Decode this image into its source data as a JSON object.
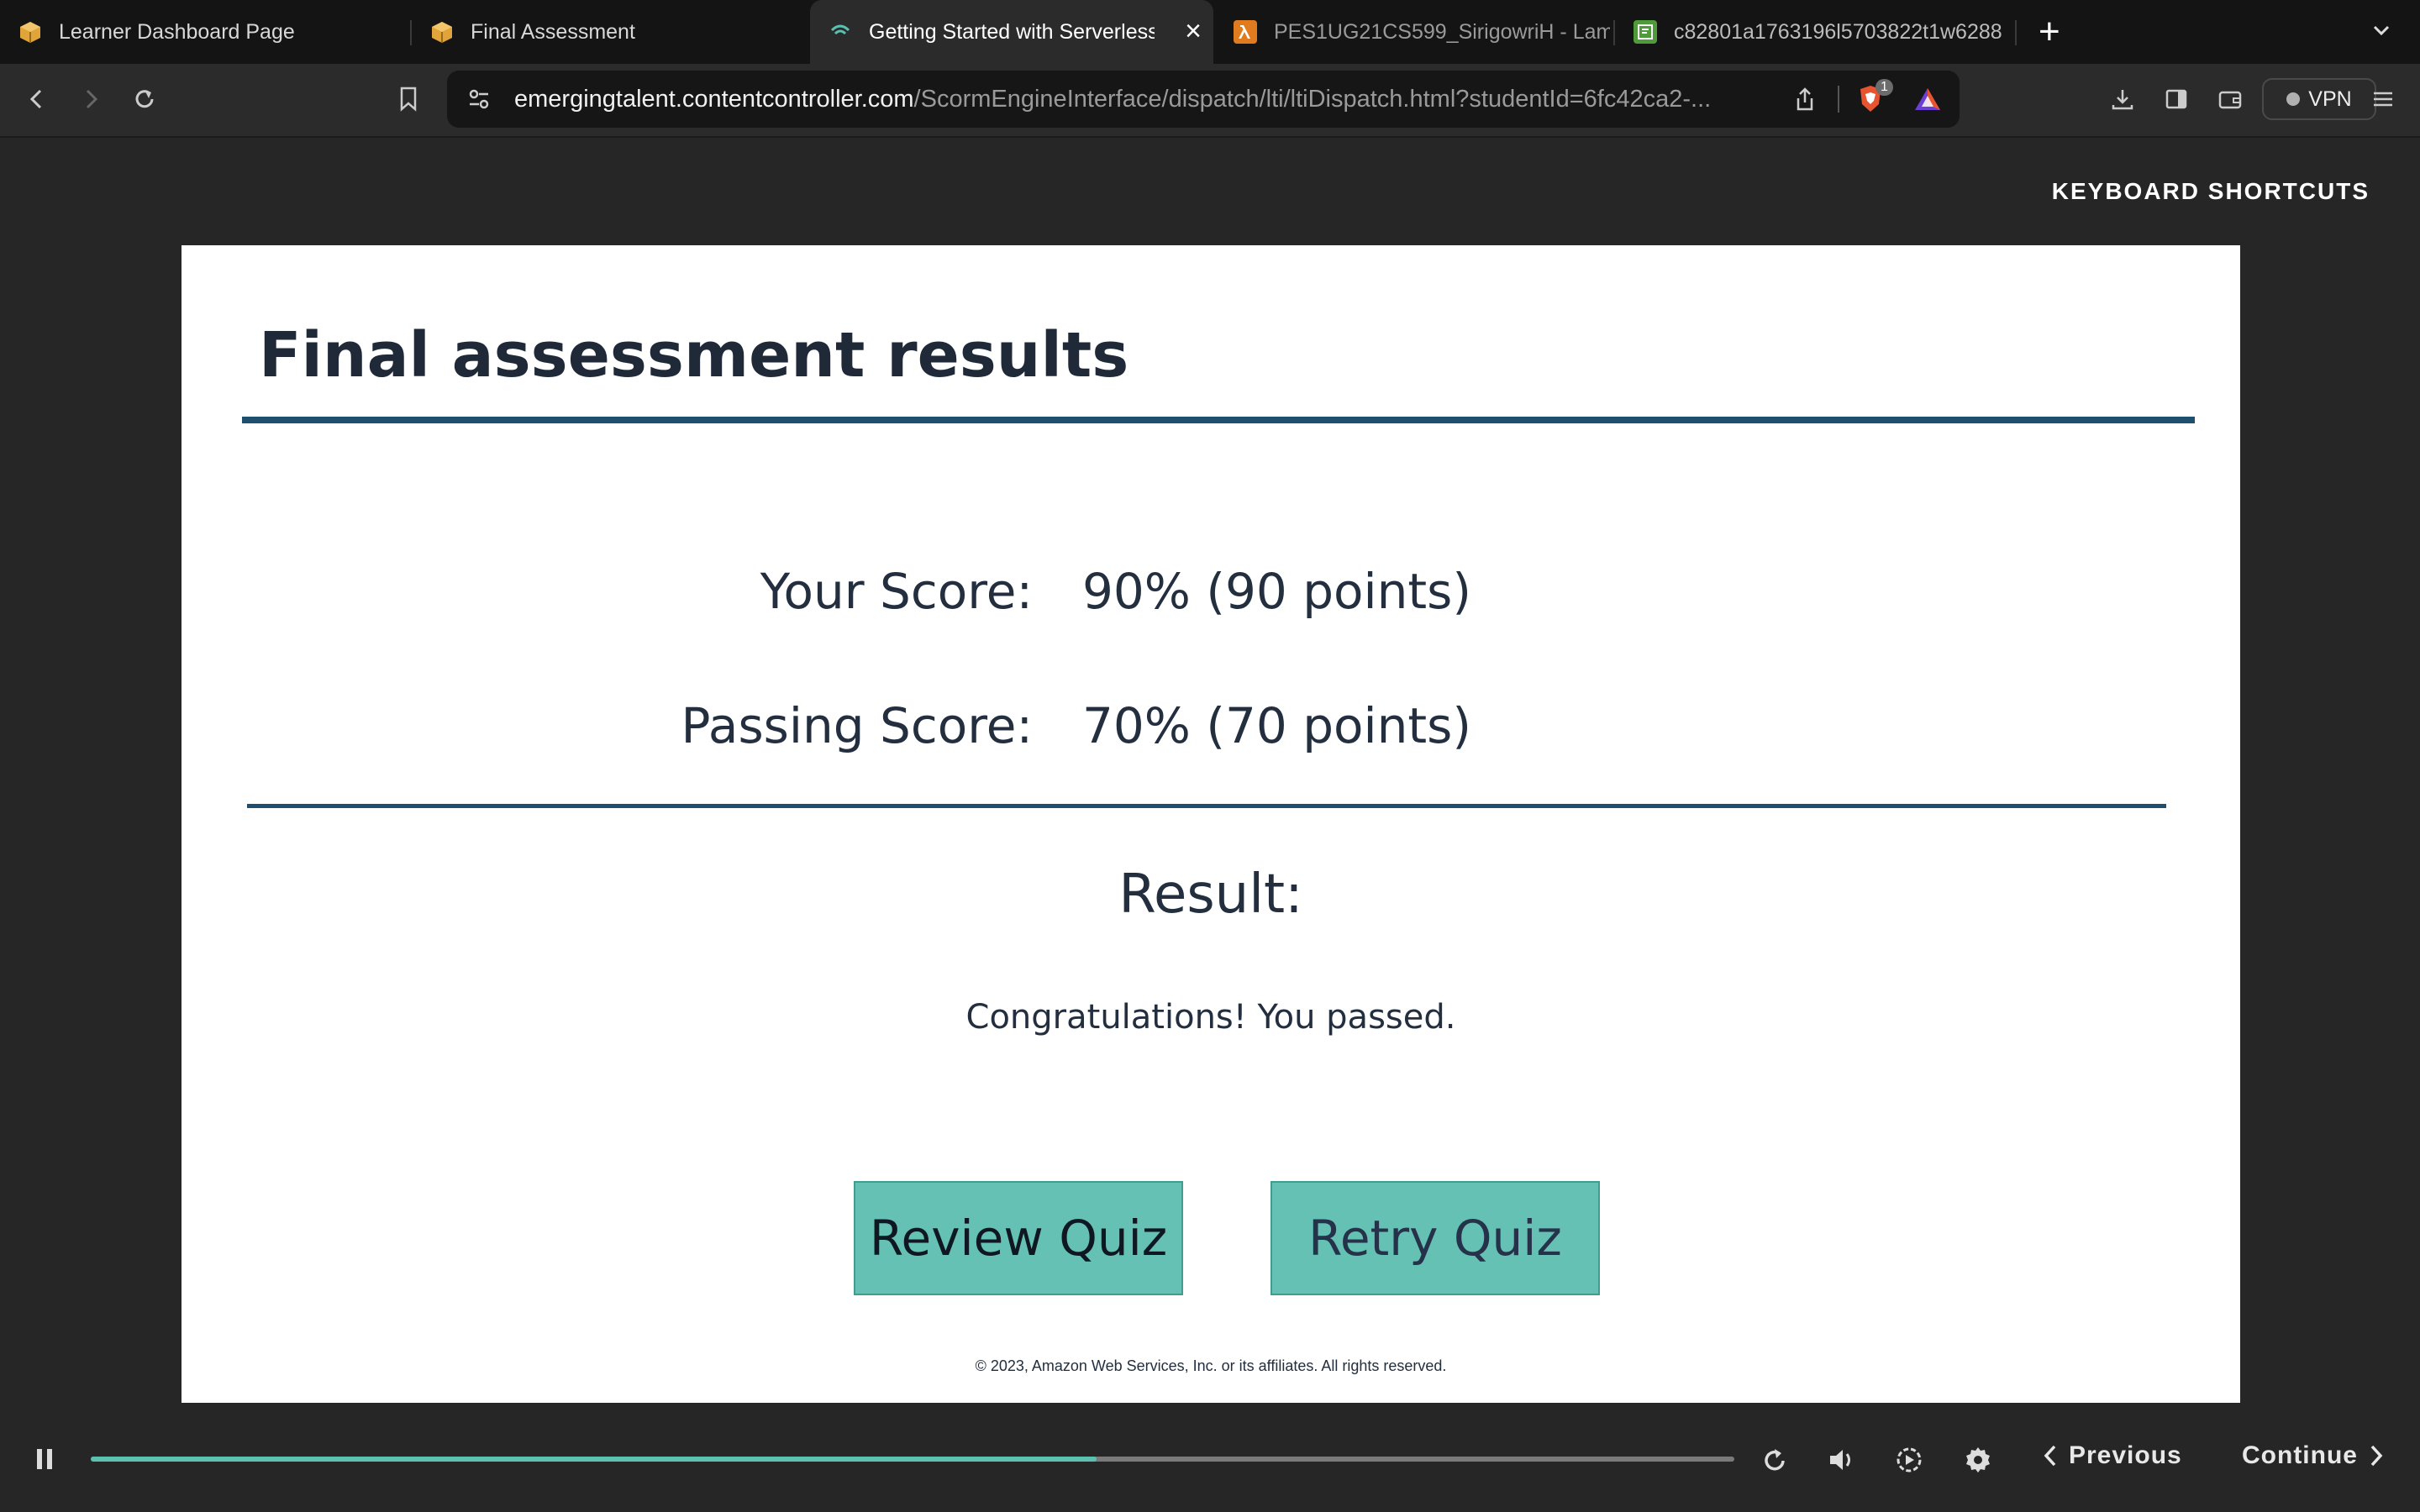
{
  "browser": {
    "tabs": [
      {
        "title": "Learner Dashboard Page",
        "icon": "package-icon"
      },
      {
        "title": "Final Assessment",
        "icon": "package-icon"
      },
      {
        "title": "Getting Started with Serverless",
        "icon": "wifi-loading-icon",
        "active": true
      },
      {
        "title": "PES1UG21CS599_SirigowriH - Lamb",
        "icon": "lambda-icon"
      },
      {
        "title": "c82801a1763196l5703822t1w6288",
        "icon": "lab-icon"
      }
    ],
    "url_host": "emergingtalent.contentcontroller.com",
    "url_path": "/ScormEngineInterface/dispatch/lti/ltiDispatch.html?studentId=6fc42ca2-...",
    "shields_badge": "1",
    "vpn_label": "VPN"
  },
  "course": {
    "keyboard_shortcuts": "KEYBOARD SHORTCUTS",
    "title": "Final assessment results",
    "your_score_label": "Your Score:",
    "your_score_value": "90% (90 points)",
    "passing_score_label": "Passing Score:",
    "passing_score_value": "70% (70 points)",
    "result_heading": "Result:",
    "result_message": "Congratulations! You passed.",
    "review_button": "Review Quiz",
    "retry_button": "Retry Quiz",
    "copyright": "© 2023, Amazon Web Services, Inc. or its affiliates. All rights reserved."
  },
  "player": {
    "progress_fraction": 0.612,
    "previous_label": "Previous",
    "continue_label": "Continue"
  },
  "colors": {
    "accent_rule": "#1e4f6e",
    "button_teal": "#64c1b3",
    "progress_teal": "#5cc0b0"
  }
}
